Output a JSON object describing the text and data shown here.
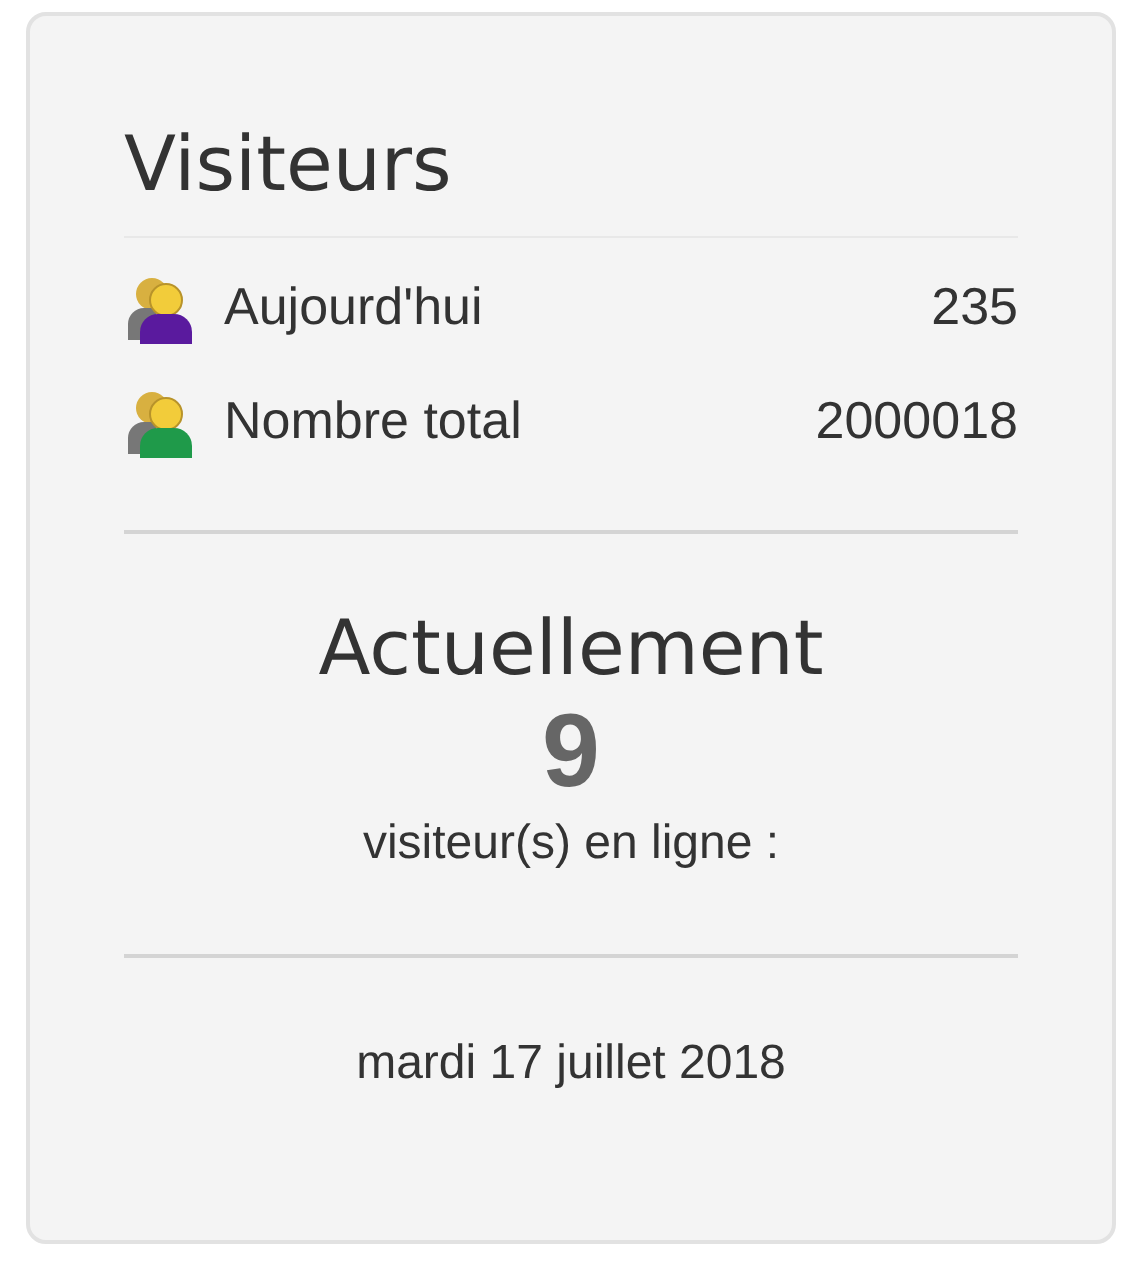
{
  "title": "Visiteurs",
  "stats": [
    {
      "label": "Aujourd'hui",
      "value": "235",
      "color": "#5a1a9e"
    },
    {
      "label": "Nombre total",
      "value": "2000018",
      "color": "#1f9a4a"
    }
  ],
  "current": {
    "heading": "Actuellement",
    "count": "9",
    "caption": "visiteur(s) en ligne :"
  },
  "date": "mardi 17 juillet 2018"
}
